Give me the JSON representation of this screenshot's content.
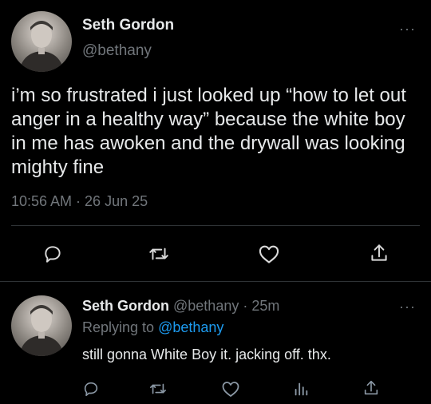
{
  "main_tweet": {
    "author_name": "Seth Gordon",
    "handle": "@bethany",
    "text": "i’m so frustrated i just looked up “how to let out anger in a healthy way” because the white boy in me has awoken and the drywall was looking mighty fine",
    "timestamp": "10:56 AM · 26 Jun 25",
    "more_label": "···",
    "actions": [
      "reply-icon",
      "retweet-icon",
      "like-icon",
      "share-icon"
    ]
  },
  "reply_tweet": {
    "author_name": "Seth Gordon",
    "handle_time": "@bethany · 25m",
    "replying_prefix": "Replying to ",
    "replying_handle": "@bethany",
    "text": "still gonna White Boy it. jacking off. thx.",
    "more_label": "···",
    "actions": [
      "reply-icon",
      "retweet-icon",
      "like-icon",
      "analytics-icon",
      "share-icon"
    ]
  },
  "colors": {
    "background": "#000000",
    "text": "#e7e9ea",
    "muted": "#71767b",
    "link": "#1d9bf0",
    "divider": "#2f3336"
  }
}
